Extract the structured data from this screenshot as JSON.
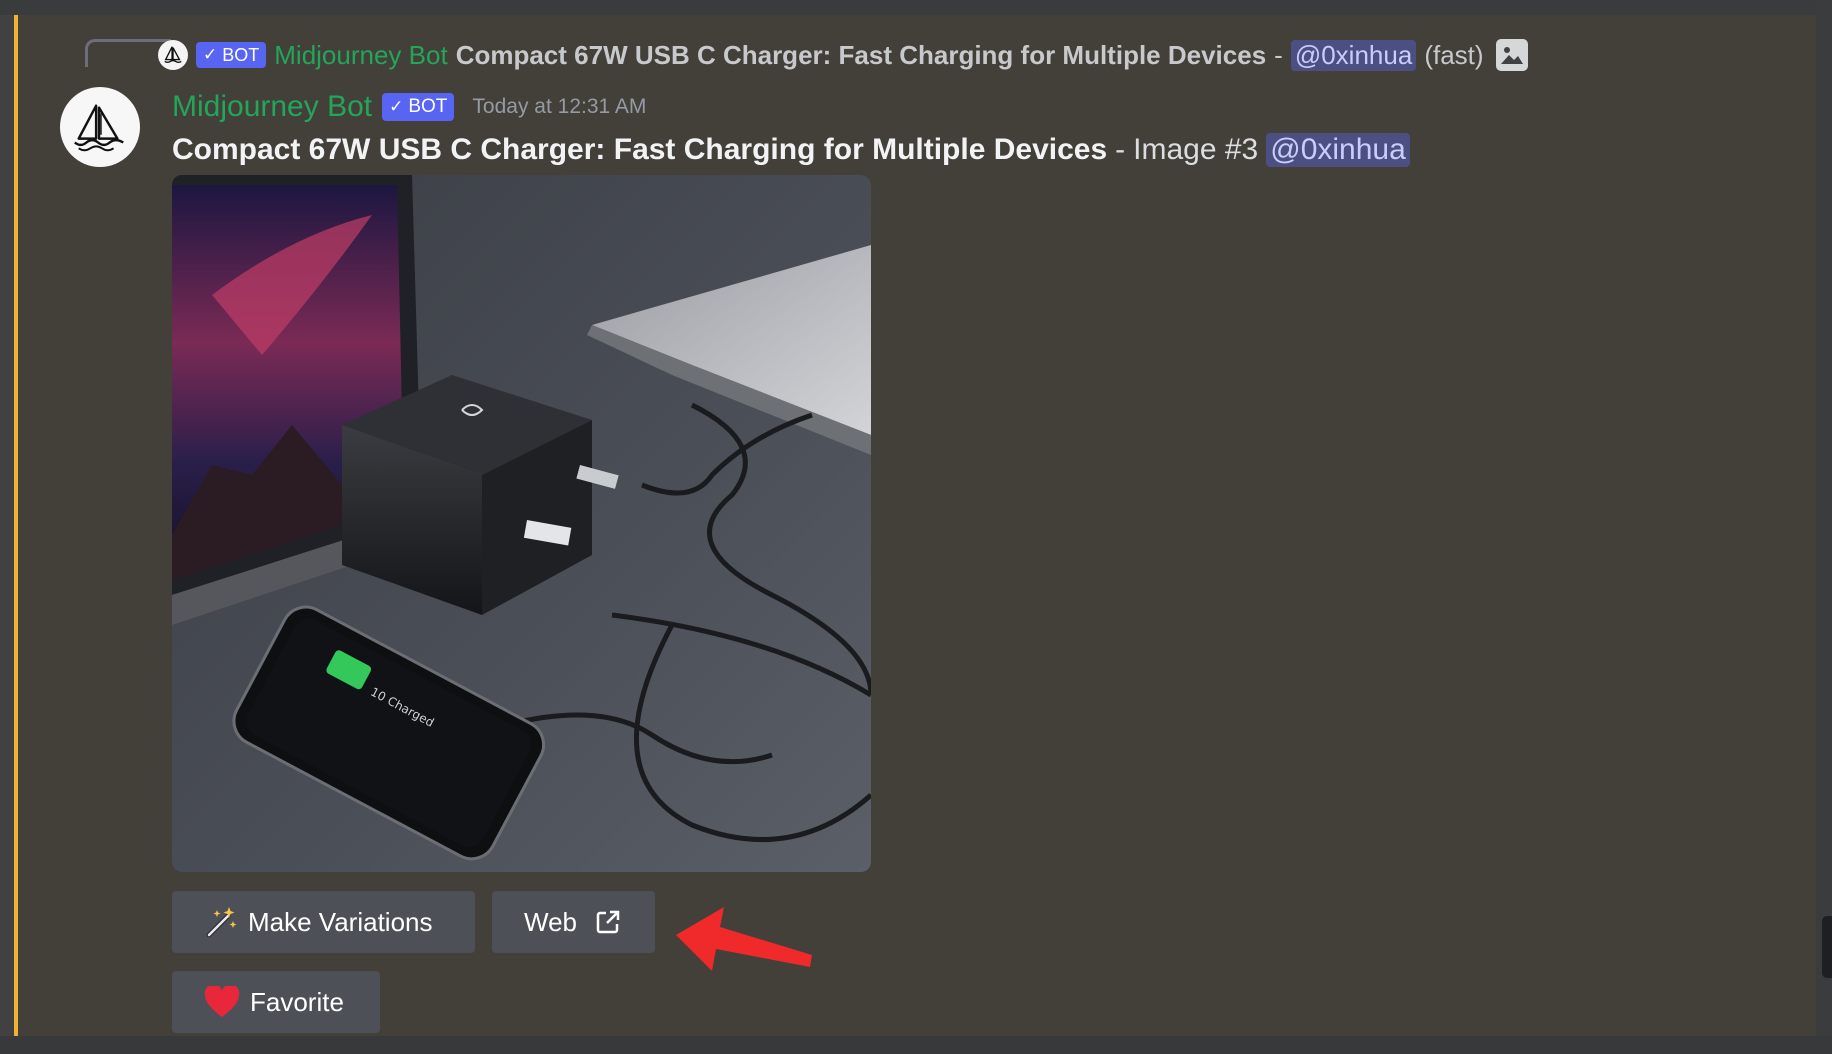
{
  "reply": {
    "badge": "BOT",
    "author": "Midjourney Bot",
    "title": "Compact 67W USB C Charger: Fast Charging for Multiple Devices",
    "separator": "-",
    "mention": "@0xinhua",
    "speed": "(fast)",
    "icon": "image-icon"
  },
  "message": {
    "author": "Midjourney Bot",
    "badge": "BOT",
    "timestamp": "Today at 12:31 AM",
    "title": "Compact 67W USB C Charger: Fast Charging for Multiple Devices",
    "separator": "-",
    "image_label": "Image #3",
    "mention": "@0xinhua",
    "phone_screen_text": "10 Charged"
  },
  "buttons": {
    "make_variations": "Make Variations",
    "web": "Web",
    "favorite": "Favorite"
  },
  "colors": {
    "bot_green": "#23a55a",
    "badge_blurple": "#5865f2",
    "highlight": "#f0b232",
    "heart": "#e8283a",
    "arrow": "#f02a2a"
  }
}
